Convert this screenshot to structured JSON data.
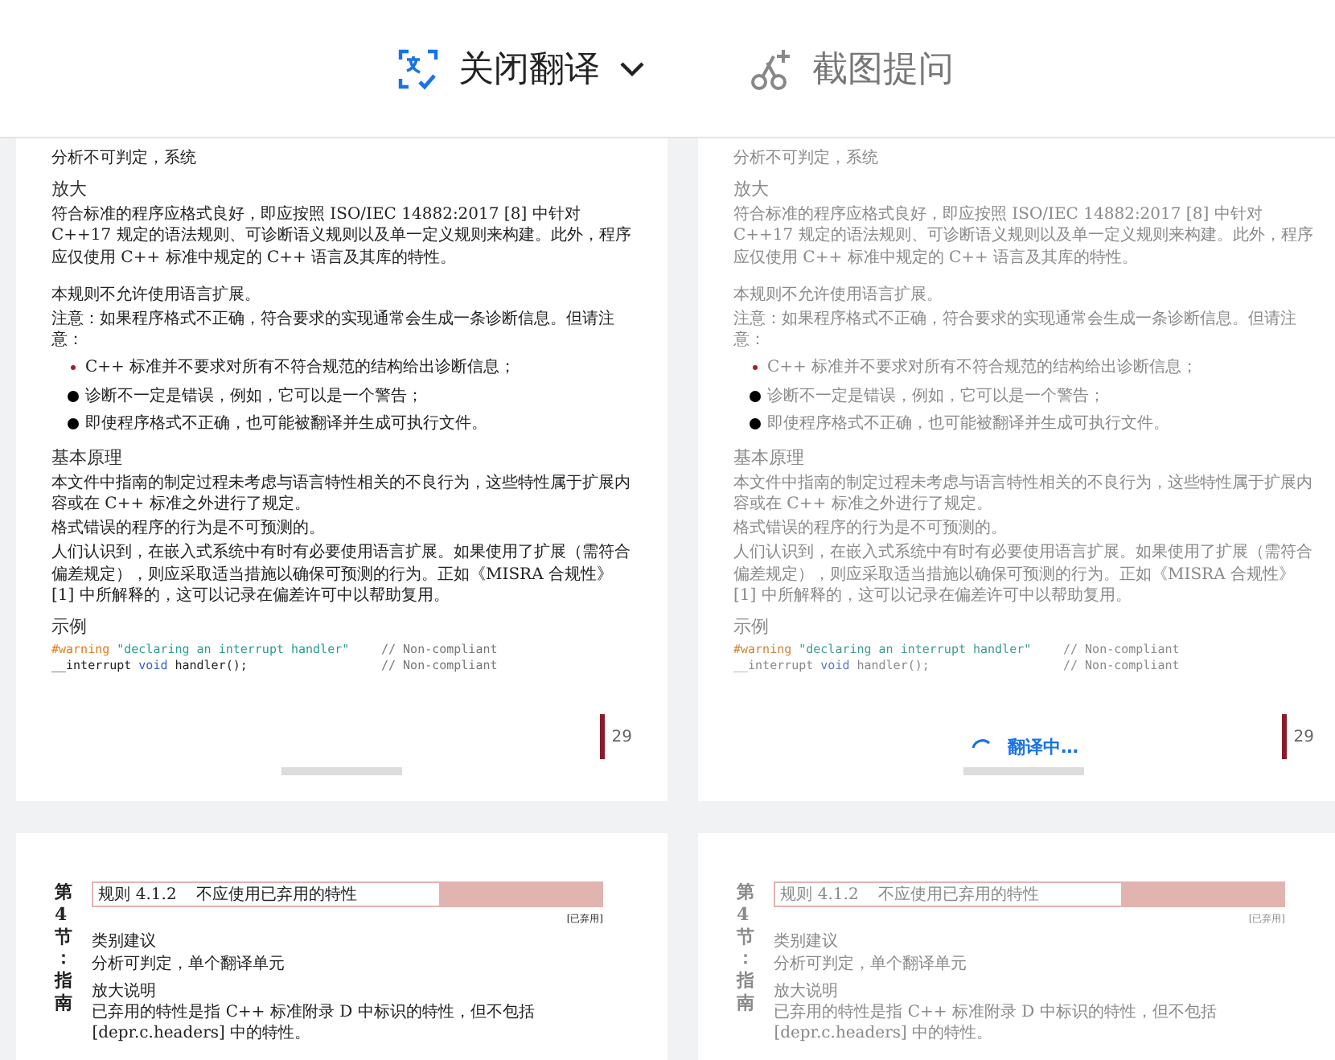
{
  "toolbar": {
    "translate": {
      "label": "关闭翻译"
    },
    "ask": {
      "label": "截图提问"
    }
  },
  "pages": [
    {
      "kind": "text",
      "faded": false,
      "page_number": "29",
      "blocks": [
        {
          "kind": "para",
          "text": "分析不可判定，系统"
        },
        {
          "kind": "heading",
          "text": "放大"
        },
        {
          "kind": "para",
          "text": "符合标准的程序应格式良好，即应按照 ISO/IEC 14882:2017 [8] 中针对 C++17 规定的语法规则、可诊断语义规则以及单一定义规则来构建。此外，程序应仅使用 C++ 标准中规定的 C++ 语言及其库的特性。"
        },
        {
          "kind": "gap"
        },
        {
          "kind": "para",
          "text": "本规则不允许使用语言扩展。"
        },
        {
          "kind": "para",
          "text": "注意：如果程序格式不正确，符合要求的实现通常会生成一条诊断信息。但请注意："
        },
        {
          "kind": "bullets",
          "items": [
            {
              "kind": "accent",
              "text": "C++ 标准并不要求对所有不符合规范的结构给出诊断信息；"
            },
            {
              "kind": "disc",
              "text": "诊断不一定是错误，例如，它可以是一个警告；"
            },
            {
              "kind": "disc",
              "text": "即使程序格式不正确，也可能被翻译并生成可执行文件。"
            }
          ]
        },
        {
          "kind": "heading",
          "text": "基本原理"
        },
        {
          "kind": "para",
          "text": "本文件中指南的制定过程未考虑与语言特性相关的不良行为，这些特性属于扩展内容或在 C++ 标准之外进行了规定。"
        },
        {
          "kind": "para",
          "text": "格式错误的程序的行为是不可预测的。"
        },
        {
          "kind": "para",
          "text": "人们认识到，在嵌入式系统中有时有必要使用语言扩展。如果使用了扩展（需符合偏差规定），则应采取适当措施以确保可预测的行为。正如《MISRA 合规性》[1] 中所解释的，这可以记录在偏差许可中以帮助复用。"
        },
        {
          "kind": "heading",
          "text": "示例"
        },
        {
          "kind": "code",
          "lines": [
            {
              "segments": [
                {
                  "kind": "directive",
                  "text": "#warning"
                },
                {
                  "kind": "string",
                  "text": "\"declaring an interrupt handler\""
                }
              ],
              "comment": "// Non-compliant"
            },
            {
              "segments": [
                {
                  "kind": "plain",
                  "text": "__interrupt"
                },
                {
                  "kind": "keyword",
                  "text": "void"
                },
                {
                  "kind": "plain",
                  "text": "handler();"
                }
              ],
              "comment": "// Non-compliant"
            }
          ]
        }
      ]
    },
    {
      "kind": "text",
      "faded": true,
      "page_number": "29",
      "loading": "翻译中…",
      "blocks": [
        {
          "kind": "para",
          "text": "分析不可判定，系统"
        },
        {
          "kind": "heading",
          "text": "放大"
        },
        {
          "kind": "para",
          "text": "符合标准的程序应格式良好，即应按照 ISO/IEC 14882:2017 [8] 中针对 C++17 规定的语法规则、可诊断语义规则以及单一定义规则来构建。此外，程序应仅使用 C++ 标准中规定的 C++ 语言及其库的特性。"
        },
        {
          "kind": "gap"
        },
        {
          "kind": "para",
          "text": "本规则不允许使用语言扩展。"
        },
        {
          "kind": "para",
          "text": "注意：如果程序格式不正确，符合要求的实现通常会生成一条诊断信息。但请注意："
        },
        {
          "kind": "bullets",
          "items": [
            {
              "kind": "accent",
              "text": "C++ 标准并不要求对所有不符合规范的结构给出诊断信息；"
            },
            {
              "kind": "disc",
              "text": "诊断不一定是错误，例如，它可以是一个警告；"
            },
            {
              "kind": "disc",
              "text": "即使程序格式不正确，也可能被翻译并生成可执行文件。"
            }
          ]
        },
        {
          "kind": "heading",
          "text": "基本原理"
        },
        {
          "kind": "para",
          "text": "本文件中指南的制定过程未考虑与语言特性相关的不良行为，这些特性属于扩展内容或在 C++ 标准之外进行了规定。"
        },
        {
          "kind": "para",
          "text": "格式错误的程序的行为是不可预测的。"
        },
        {
          "kind": "para",
          "text": "人们认识到，在嵌入式系统中有时有必要使用语言扩展。如果使用了扩展（需符合偏差规定），则应采取适当措施以确保可预测的行为。正如《MISRA 合规性》[1] 中所解释的，这可以记录在偏差许可中以帮助复用。"
        },
        {
          "kind": "heading",
          "text": "示例"
        },
        {
          "kind": "code",
          "lines": [
            {
              "segments": [
                {
                  "kind": "directive",
                  "text": "#warning"
                },
                {
                  "kind": "string",
                  "text": "\"declaring an interrupt handler\""
                }
              ],
              "comment": "// Non-compliant"
            },
            {
              "segments": [
                {
                  "kind": "plain",
                  "text": "__interrupt"
                },
                {
                  "kind": "keyword",
                  "text": "void"
                },
                {
                  "kind": "plain",
                  "text": "handler();"
                }
              ],
              "comment": "// Non-compliant"
            }
          ]
        }
      ]
    },
    {
      "kind": "rule",
      "faded": false,
      "section": "第4节：指南",
      "rule_id": "规则 4.1.2",
      "rule_title": "不应使用已弃用的特性",
      "tag": "[已弃用]",
      "lines": [
        {
          "kind": "small",
          "text": "类别建议"
        },
        {
          "kind": "small",
          "text": "分析可判定，单个翻译单元"
        },
        {
          "kind": "heading",
          "text": "放大说明"
        },
        {
          "kind": "small",
          "text": "已弃用的特性是指 C++ 标准附录 D 中标识的特性，但不包括 [depr.c.headers] 中的特性。"
        }
      ]
    },
    {
      "kind": "rule",
      "faded": true,
      "section": "第4节：指南",
      "rule_id": "规则 4.1.2",
      "rule_title": "不应使用已弃用的特性",
      "tag": "[已弃用]",
      "lines": [
        {
          "kind": "small",
          "text": "类别建议"
        },
        {
          "kind": "small",
          "text": "分析可判定，单个翻译单元"
        },
        {
          "kind": "heading",
          "text": "放大说明"
        },
        {
          "kind": "small",
          "text": "已弃用的特性是指 C++ 标准附录 D 中标识的特性，但不包括 [depr.c.headers] 中的特性。"
        }
      ]
    }
  ]
}
